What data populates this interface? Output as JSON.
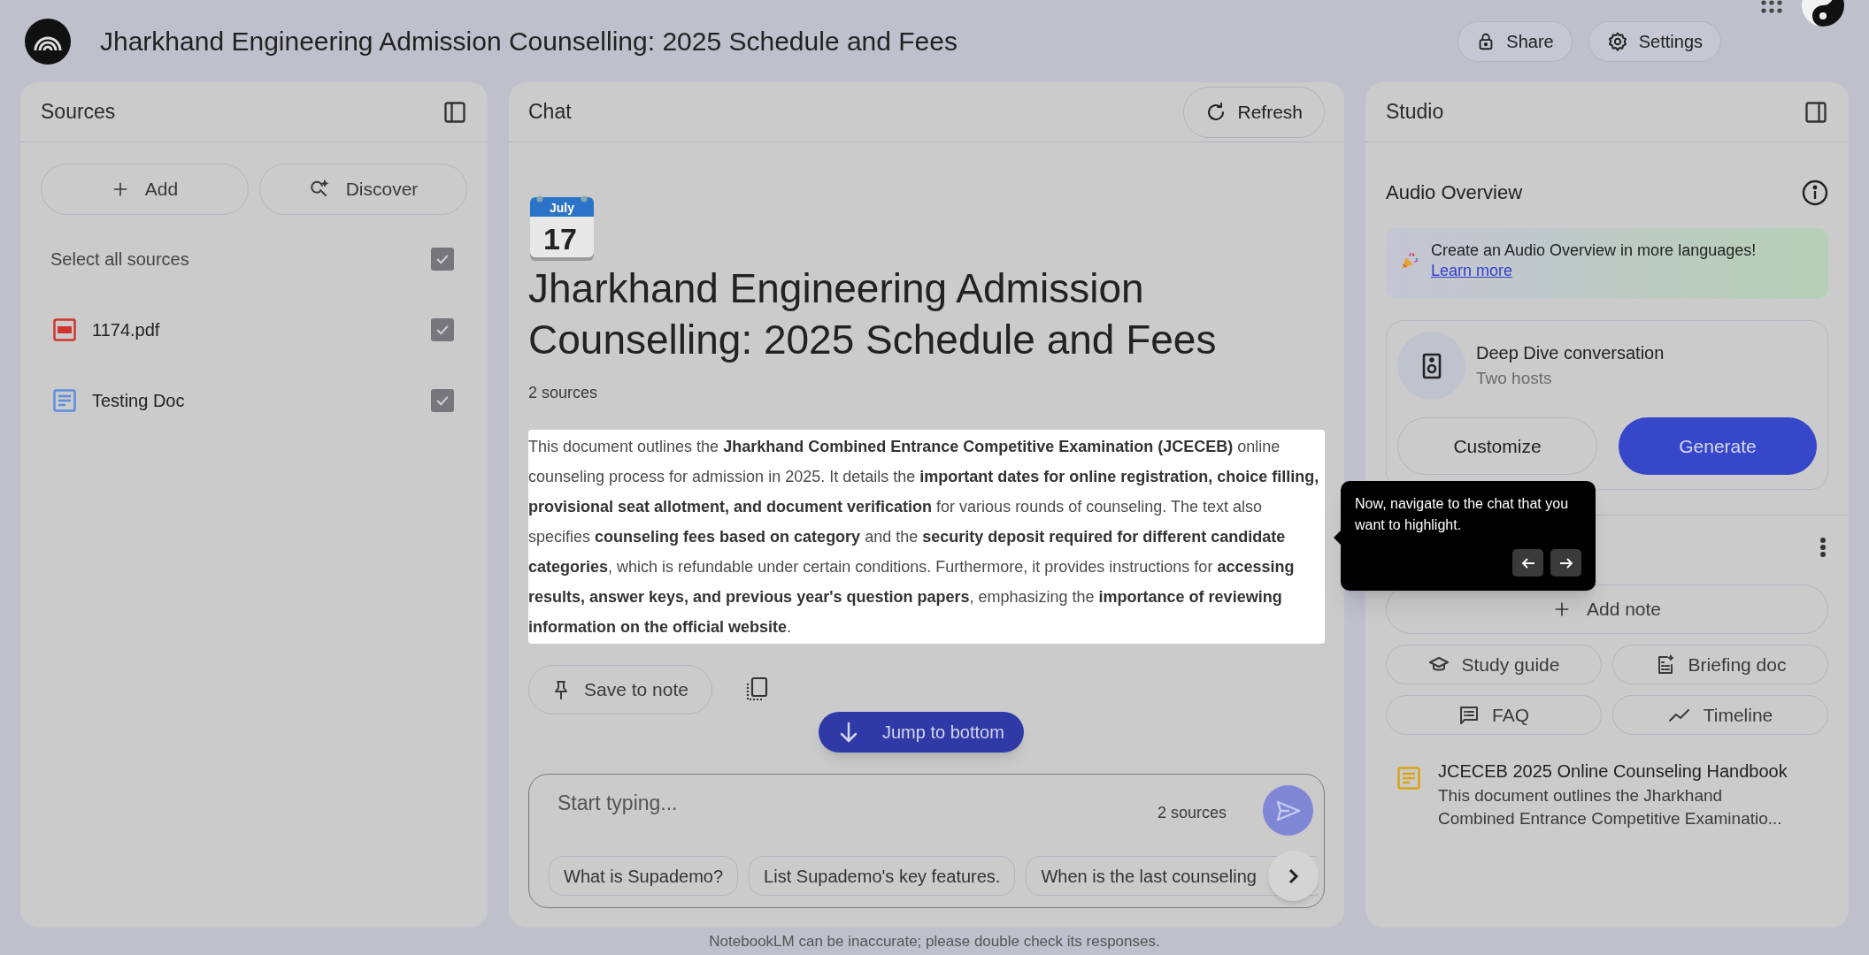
{
  "header": {
    "title": "Jharkhand Engineering Admission Counselling: 2025 Schedule and Fees",
    "buttons": [
      {
        "kind": "share",
        "label": "Share"
      },
      {
        "kind": "settings",
        "label": "Settings"
      }
    ]
  },
  "sources": {
    "title": "Sources",
    "actions": [
      {
        "kind": "add",
        "label": "Add"
      },
      {
        "kind": "discover",
        "label": "Discover"
      }
    ],
    "select_all": {
      "label": "Select all sources",
      "checked": true
    },
    "items": [
      {
        "kind": "pdf",
        "name": "1174.pdf",
        "checked": true
      },
      {
        "kind": "doc",
        "name": "Testing Doc",
        "checked": true
      }
    ]
  },
  "chat": {
    "title": "Chat",
    "refresh": "Refresh",
    "calendar": {
      "month": "July",
      "day": "17"
    },
    "heading": "Jharkhand Engineering Admission Counselling: 2025 Schedule and Fees",
    "source_count": "2 sources",
    "summary": "This document outlines the **Jharkhand Combined Entrance Competitive Examination (JCECEB)** online counseling process for admission in 2025. It details the **important dates for online registration, choice filling, provisional seat allotment, and document verification** for various rounds of counseling. The text also specifies **counseling fees based on category** and the **security deposit required for different candidate categories**, which is refundable under certain conditions. Furthermore, it provides instructions for **accessing results, answer keys, and previous year's question papers**, emphasizing the **importance of reviewing information on the official website**.",
    "save_to_note": "Save to note",
    "jump": "Jump to bottom",
    "input": {
      "placeholder": "Start typing...",
      "source_count": "2 sources"
    },
    "suggestions": [
      "What is Supademo?",
      "List Supademo's key features.",
      "When is the last counseling"
    ]
  },
  "studio": {
    "title": "Studio",
    "audio_title": "Audio Overview",
    "banner": {
      "text": "Create an Audio Overview in more languages!",
      "link": "Learn more"
    },
    "audio_card": {
      "title": "Deep Dive conversation",
      "subtitle": "Two hosts",
      "customize": "Customize",
      "generate": "Generate"
    },
    "add_note": "Add note",
    "tools": [
      {
        "kind": "study",
        "label": "Study guide"
      },
      {
        "kind": "briefing",
        "label": "Briefing doc"
      },
      {
        "kind": "faq",
        "label": "FAQ"
      },
      {
        "kind": "timeline",
        "label": "Timeline"
      }
    ],
    "notes": [
      {
        "title": "JCECEB 2025 Online Counseling Handbook",
        "snippet": "This document outlines the Jharkhand Combined Entrance Competitive Examinatio..."
      }
    ]
  },
  "tooltip": {
    "text": "Now, navigate to the chat that you want to highlight."
  },
  "footer": "NotebookLM can be inaccurate; please double check its responses."
}
